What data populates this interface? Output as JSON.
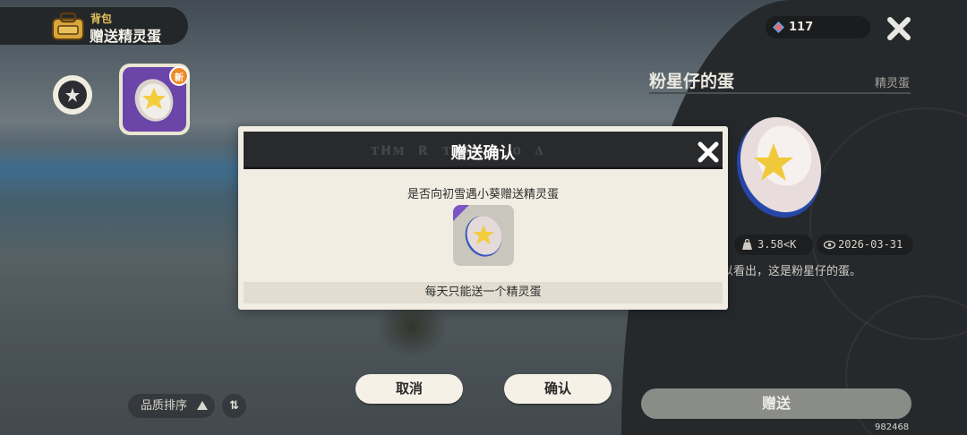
{
  "header": {
    "subtitle": "背包",
    "title": "赠送精灵蛋"
  },
  "inventory": {
    "new_badge": "新"
  },
  "sort": {
    "label": "品质排序",
    "toggle_label": "⇅"
  },
  "currency": {
    "amount": "117"
  },
  "detail": {
    "name": "粉星仔的蛋",
    "type": "精灵蛋",
    "weight": "3.58<K",
    "date": "2026-03-31",
    "description": "以看出，这是粉星仔的蛋。",
    "gift_button": "赠送",
    "uid": "982468"
  },
  "modal": {
    "title": "赠送确认",
    "question": "是否向初雪遇小葵赠送精灵蛋",
    "note": "每天只能送一个精灵蛋"
  },
  "buttons": {
    "cancel": "取消",
    "confirm": "确认"
  },
  "colors": {
    "accent_purple": "#6b45a8",
    "badge_orange": "#f08a2a",
    "gold": "#e3c15a"
  }
}
